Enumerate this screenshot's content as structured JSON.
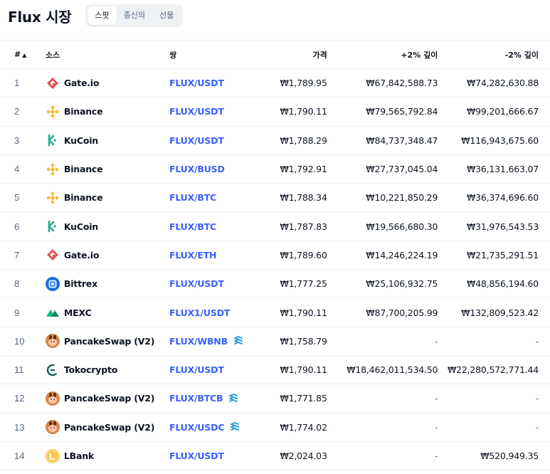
{
  "page": {
    "title": "Flux 시장"
  },
  "tabs": [
    {
      "label": "스팟",
      "active": true
    },
    {
      "label": "종신의",
      "active": false
    },
    {
      "label": "선물",
      "active": false
    }
  ],
  "table": {
    "headers": {
      "rank": "#",
      "rank_sort_icon": "▲",
      "source": "소스",
      "pair": "쌍",
      "price": "가격",
      "depth_plus": "+2% 깊이",
      "depth_minus": "-2% 깊이"
    },
    "rows": [
      {
        "rank": "1",
        "source": "Gate.io",
        "logo": "gateio-icon",
        "pair": "FLUX/USDT",
        "chain_icon": false,
        "price": "₩1,789.95",
        "depth_plus": "₩67,842,588.73",
        "depth_minus": "₩74,282,630.88"
      },
      {
        "rank": "2",
        "source": "Binance",
        "logo": "binance-icon",
        "pair": "FLUX/USDT",
        "chain_icon": false,
        "price": "₩1,790.11",
        "depth_plus": "₩79,565,792.84",
        "depth_minus": "₩99,201,666.67"
      },
      {
        "rank": "3",
        "source": "KuCoin",
        "logo": "kucoin-icon",
        "pair": "FLUX/USDT",
        "chain_icon": false,
        "price": "₩1,788.29",
        "depth_plus": "₩84,737,348.47",
        "depth_minus": "₩116,943,675.60"
      },
      {
        "rank": "4",
        "source": "Binance",
        "logo": "binance-icon",
        "pair": "FLUX/BUSD",
        "chain_icon": false,
        "price": "₩1,792.91",
        "depth_plus": "₩27,737,045.04",
        "depth_minus": "₩36,131,663.07"
      },
      {
        "rank": "5",
        "source": "Binance",
        "logo": "binance-icon",
        "pair": "FLUX/BTC",
        "chain_icon": false,
        "price": "₩1,788.34",
        "depth_plus": "₩10,221,850.29",
        "depth_minus": "₩36,374,696.60"
      },
      {
        "rank": "6",
        "source": "KuCoin",
        "logo": "kucoin-icon",
        "pair": "FLUX/BTC",
        "chain_icon": false,
        "price": "₩1,787.83",
        "depth_plus": "₩19,566,680.30",
        "depth_minus": "₩31,976,543.53"
      },
      {
        "rank": "7",
        "source": "Gate.io",
        "logo": "gateio-icon",
        "pair": "FLUX/ETH",
        "chain_icon": false,
        "price": "₩1,789.60",
        "depth_plus": "₩14,246,224.19",
        "depth_minus": "₩21,735,291.51"
      },
      {
        "rank": "8",
        "source": "Bittrex",
        "logo": "bittrex-icon",
        "pair": "FLUX/USDT",
        "chain_icon": false,
        "price": "₩1,777.25",
        "depth_plus": "₩25,106,932.75",
        "depth_minus": "₩48,856,194.60"
      },
      {
        "rank": "9",
        "source": "MEXC",
        "logo": "mexc-icon",
        "pair": "FLUX1/USDT",
        "chain_icon": false,
        "price": "₩1,790.11",
        "depth_plus": "₩87,700,205.99",
        "depth_minus": "₩132,809,523.42"
      },
      {
        "rank": "10",
        "source": "PancakeSwap (V2)",
        "logo": "pancakeswap-icon",
        "pair": "FLUX/WBNB",
        "chain_icon": true,
        "price": "₩1,758.79",
        "depth_plus": "-",
        "depth_minus": "-"
      },
      {
        "rank": "11",
        "source": "Tokocrypto",
        "logo": "tokocrypto-icon",
        "pair": "FLUX/USDT",
        "chain_icon": false,
        "price": "₩1,790.11",
        "depth_plus": "₩18,462,011,534.50",
        "depth_minus": "₩22,280,572,771.44"
      },
      {
        "rank": "12",
        "source": "PancakeSwap (V2)",
        "logo": "pancakeswap-icon",
        "pair": "FLUX/BTCB",
        "chain_icon": true,
        "price": "₩1,771.85",
        "depth_plus": "-",
        "depth_minus": "-"
      },
      {
        "rank": "13",
        "source": "PancakeSwap (V2)",
        "logo": "pancakeswap-icon",
        "pair": "FLUX/USDC",
        "chain_icon": true,
        "price": "₩1,774.02",
        "depth_plus": "-",
        "depth_minus": "-"
      },
      {
        "rank": "14",
        "source": "LBank",
        "logo": "lbank-icon",
        "pair": "FLUX/USDT",
        "chain_icon": false,
        "price": "₩2,024.03",
        "depth_plus": "-",
        "depth_minus": "₩520,949.35"
      }
    ]
  },
  "colors": {
    "link": "#3861fb",
    "text": "#0d1421",
    "muted": "#58667e",
    "border": "#eff2f5"
  }
}
